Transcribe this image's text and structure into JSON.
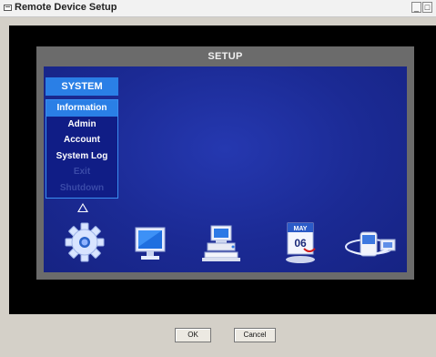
{
  "window": {
    "title": "Remote Device Setup",
    "controls": {
      "minimize": "_",
      "restore": "□"
    }
  },
  "setup": {
    "title": "SETUP",
    "system_header": "SYSTEM",
    "menu_items": [
      {
        "label": "Information",
        "state": "selected"
      },
      {
        "label": "Admin",
        "state": "normal"
      },
      {
        "label": "Account",
        "state": "normal"
      },
      {
        "label": "System Log",
        "state": "normal"
      },
      {
        "label": "Exit",
        "state": "disabled"
      },
      {
        "label": "Shutdown",
        "state": "disabled"
      }
    ],
    "icons": [
      "gear-icon",
      "monitor-icon",
      "network-computer-icon",
      "calendar-icon",
      "disk-icon"
    ],
    "calendar": {
      "month": "MAY",
      "day": "06"
    }
  },
  "buttons": {
    "ok": "OK",
    "cancel": "Cancel"
  },
  "colors": {
    "panel_bg": "#6b6b6b",
    "blue_bg": "#1d2d9a",
    "highlight": "#2a7fe6"
  }
}
